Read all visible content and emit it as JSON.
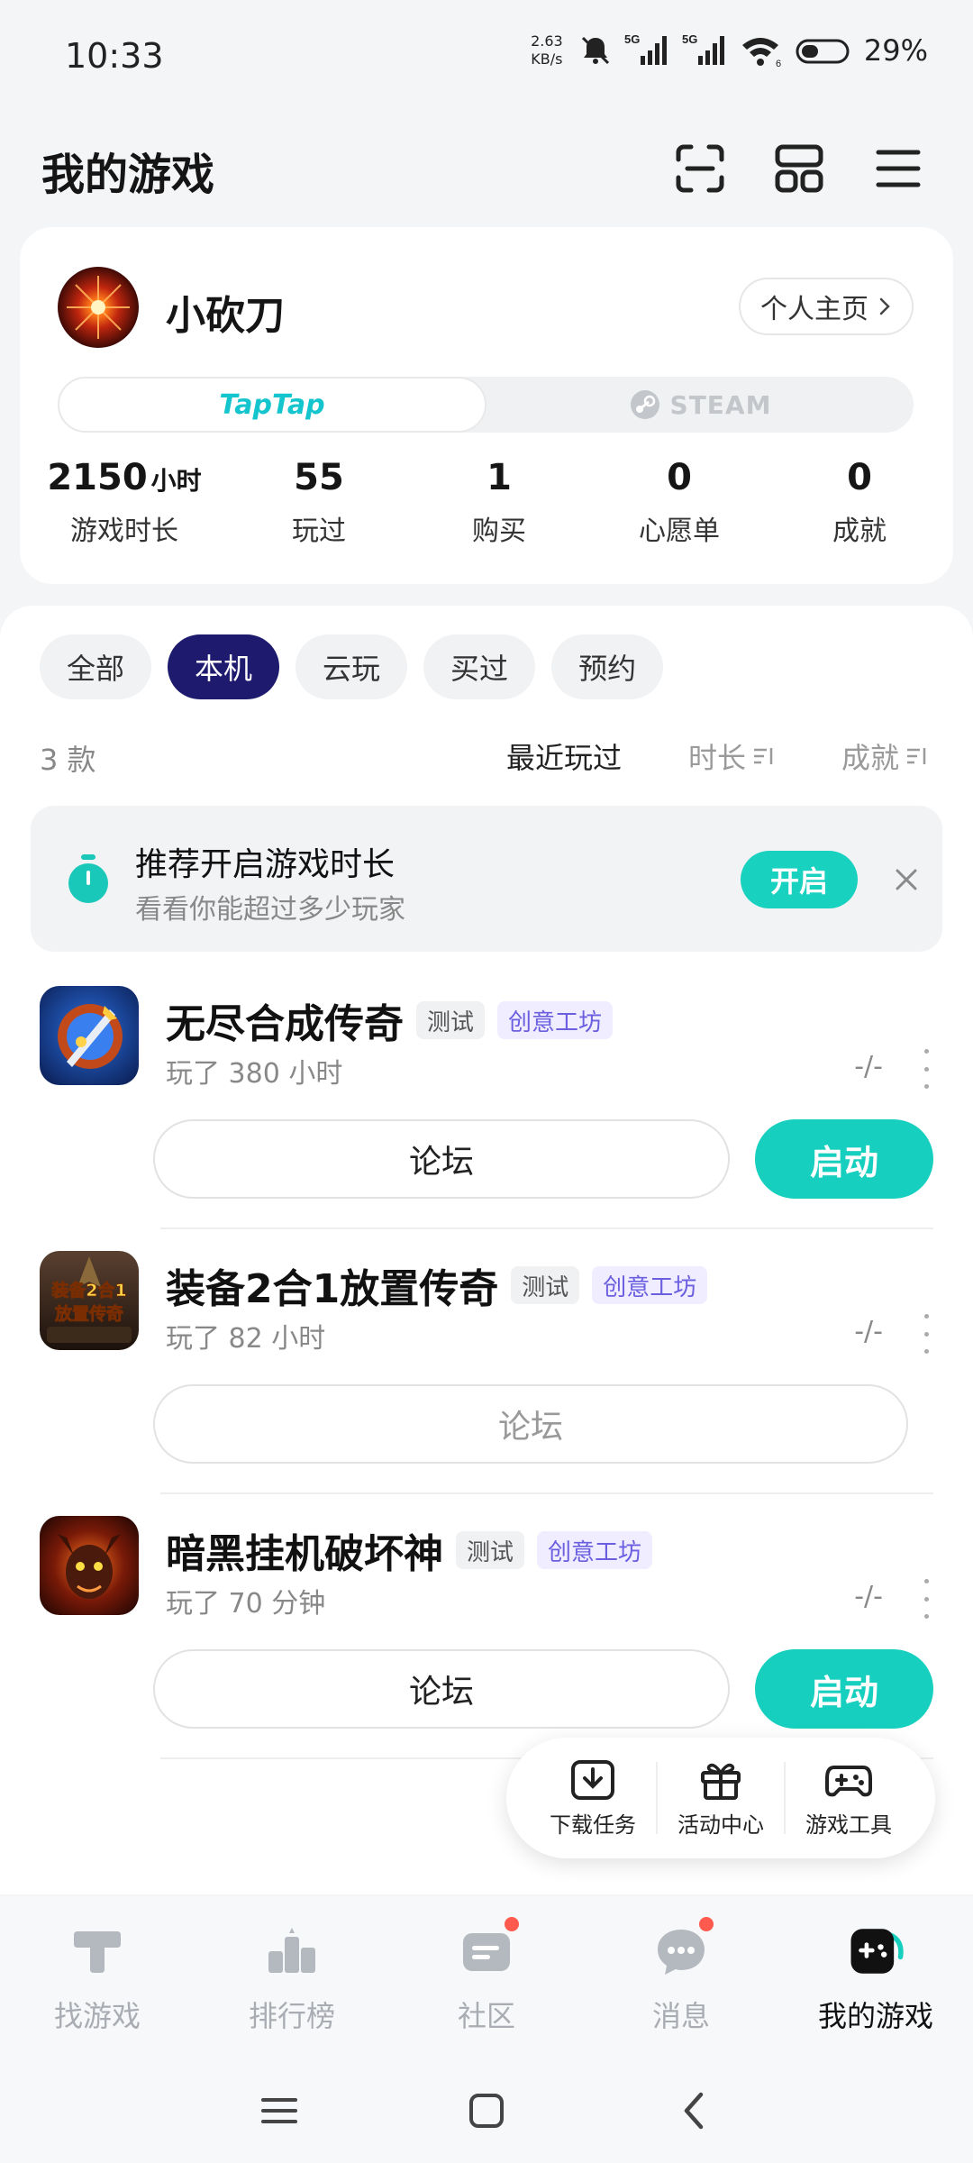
{
  "status_bar": {
    "time": "10:33",
    "net_speed_value": "2.63",
    "net_speed_unit": "KB/s",
    "signal_1": "5G",
    "signal_2": "5G",
    "wifi_badge": "6",
    "battery": "29%"
  },
  "header": {
    "title": "我的游戏",
    "icons": [
      "scan-icon",
      "grid-icon",
      "menu-icon"
    ]
  },
  "profile": {
    "username": "小砍刀",
    "profile_link": "个人主页",
    "platform_tabs": [
      {
        "label": "TapTap",
        "selected": true
      },
      {
        "label": "STEAM",
        "selected": false
      }
    ],
    "stats": [
      {
        "value": "2150",
        "unit": "小时",
        "label": "游戏时长"
      },
      {
        "value": "55",
        "unit": "",
        "label": "玩过"
      },
      {
        "value": "1",
        "unit": "",
        "label": "购买"
      },
      {
        "value": "0",
        "unit": "",
        "label": "心愿单"
      },
      {
        "value": "0",
        "unit": "",
        "label": "成就"
      }
    ]
  },
  "filters": {
    "chips": [
      {
        "label": "全部",
        "active": false
      },
      {
        "label": "本机",
        "active": true
      },
      {
        "label": "云玩",
        "active": false
      },
      {
        "label": "买过",
        "active": false
      },
      {
        "label": "预约",
        "active": false
      }
    ]
  },
  "list_header": {
    "count": "3 款",
    "sort_options": [
      {
        "label": "最近玩过",
        "active": true
      },
      {
        "label": "时长",
        "active": false
      },
      {
        "label": "成就",
        "active": false
      }
    ]
  },
  "promo": {
    "title": "推荐开启游戏时长",
    "subtitle": "看看你能超过多少玩家",
    "button": "开启"
  },
  "games": [
    {
      "title": "无尽合成传奇",
      "tags": [
        "测试",
        "创意工坊"
      ],
      "playtime": "玩了 380 小时",
      "score": "-/-",
      "forum_label": "论坛",
      "launch_label": "启动"
    },
    {
      "title": "装备2合1放置传奇",
      "tags": [
        "测试",
        "创意工坊"
      ],
      "playtime": "玩了 82 小时",
      "score": "-/-",
      "forum_label": "论坛",
      "launch_label": "",
      "icon_text": [
        "装备2合1",
        "放置传奇"
      ]
    },
    {
      "title": "暗黑挂机破坏神",
      "tags": [
        "测试",
        "创意工坊"
      ],
      "playtime": "玩了 70 分钟",
      "score": "-/-",
      "forum_label": "论坛",
      "launch_label": "启动"
    }
  ],
  "tools": [
    {
      "label": "下载任务",
      "icon": "download-icon"
    },
    {
      "label": "活动中心",
      "icon": "gift-icon"
    },
    {
      "label": "游戏工具",
      "icon": "gamepad-icon"
    }
  ],
  "bottom_nav": [
    {
      "label": "找游戏",
      "icon": "taptap-logo-icon",
      "active": false,
      "badge": false
    },
    {
      "label": "排行榜",
      "icon": "ranking-icon",
      "active": false,
      "badge": false
    },
    {
      "label": "社区",
      "icon": "community-icon",
      "active": false,
      "badge": true
    },
    {
      "label": "消息",
      "icon": "message-icon",
      "active": false,
      "badge": true
    },
    {
      "label": "我的游戏",
      "icon": "my-games-icon",
      "active": true,
      "badge": false
    }
  ],
  "colors": {
    "accent": "#17cfbe",
    "chip_active": "#1e1a6e",
    "workshop_tag": "#6b5fe0",
    "badge": "#ff5a4e"
  }
}
